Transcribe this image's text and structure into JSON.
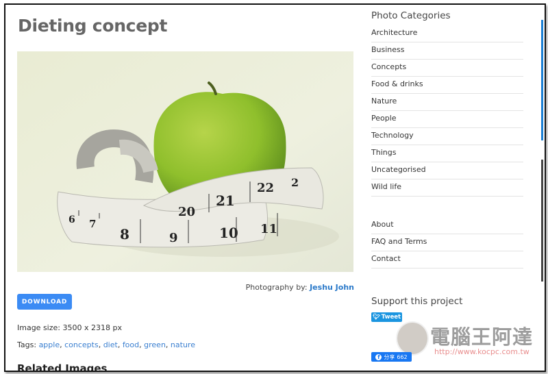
{
  "page": {
    "title": "Dieting concept",
    "photo_alt": "Green apple wrapped with a measuring tape",
    "credit_label": "Photography by:",
    "credit_author": "Jeshu John",
    "download_label": "DOWNLOAD",
    "image_size": "Image size: 3500 x 2318 px",
    "tags_label": "Tags:",
    "tags": [
      "apple",
      "concepts",
      "diet",
      "food",
      "green",
      "nature"
    ],
    "related_heading": "Related Images"
  },
  "sidebar": {
    "categories_title": "Photo Categories",
    "categories": [
      "Architecture",
      "Business",
      "Concepts",
      "Food & drinks",
      "Nature",
      "People",
      "Technology",
      "Things",
      "Uncategorised",
      "Wild life"
    ],
    "pages": [
      "About",
      "FAQ and Terms",
      "Contact"
    ],
    "support_title": "Support this project",
    "tweet_label": "Tweet",
    "fb_share_label": "分享",
    "fb_share_count": "662"
  },
  "watermark": {
    "text": "電腦王阿達",
    "url": "http://www.kocpc.com.tw"
  },
  "colors": {
    "accent_blue": "#3b8bf4",
    "link_blue": "#3a7fd0",
    "twitter_blue": "#1b95e0",
    "facebook_blue": "#1877f2"
  }
}
